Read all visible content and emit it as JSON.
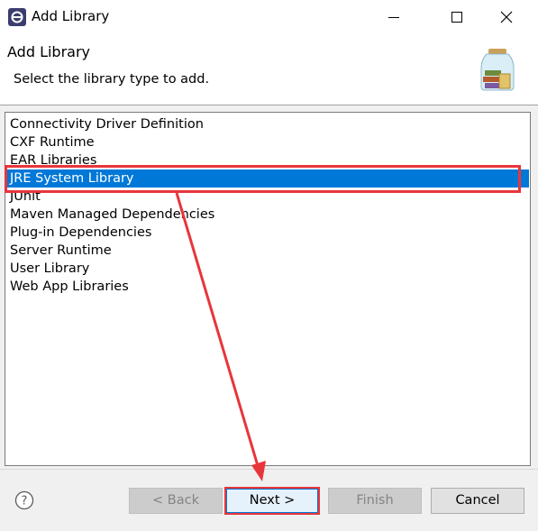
{
  "window": {
    "title": "Add Library",
    "icons": {
      "app": "eclipse-icon",
      "minimize": "minimize-icon",
      "maximize": "maximize-icon",
      "close": "close-icon"
    }
  },
  "header": {
    "title": "Add Library",
    "subtitle": "Select the library type to add.",
    "image": "library-jar-icon"
  },
  "library_types": {
    "items": [
      "Connectivity Driver Definition",
      "CXF Runtime",
      "EAR Libraries",
      "JRE System Library",
      "JUnit",
      "Maven Managed Dependencies",
      "Plug-in Dependencies",
      "Server Runtime",
      "User Library",
      "Web App Libraries"
    ],
    "selected": "JRE System Library"
  },
  "buttons": {
    "help_icon": "help-icon",
    "back": "< Back",
    "next": "Next >",
    "finish": "Finish",
    "cancel": "Cancel"
  },
  "colors": {
    "selection": "#0078d7",
    "annotation": "#e8353b"
  }
}
